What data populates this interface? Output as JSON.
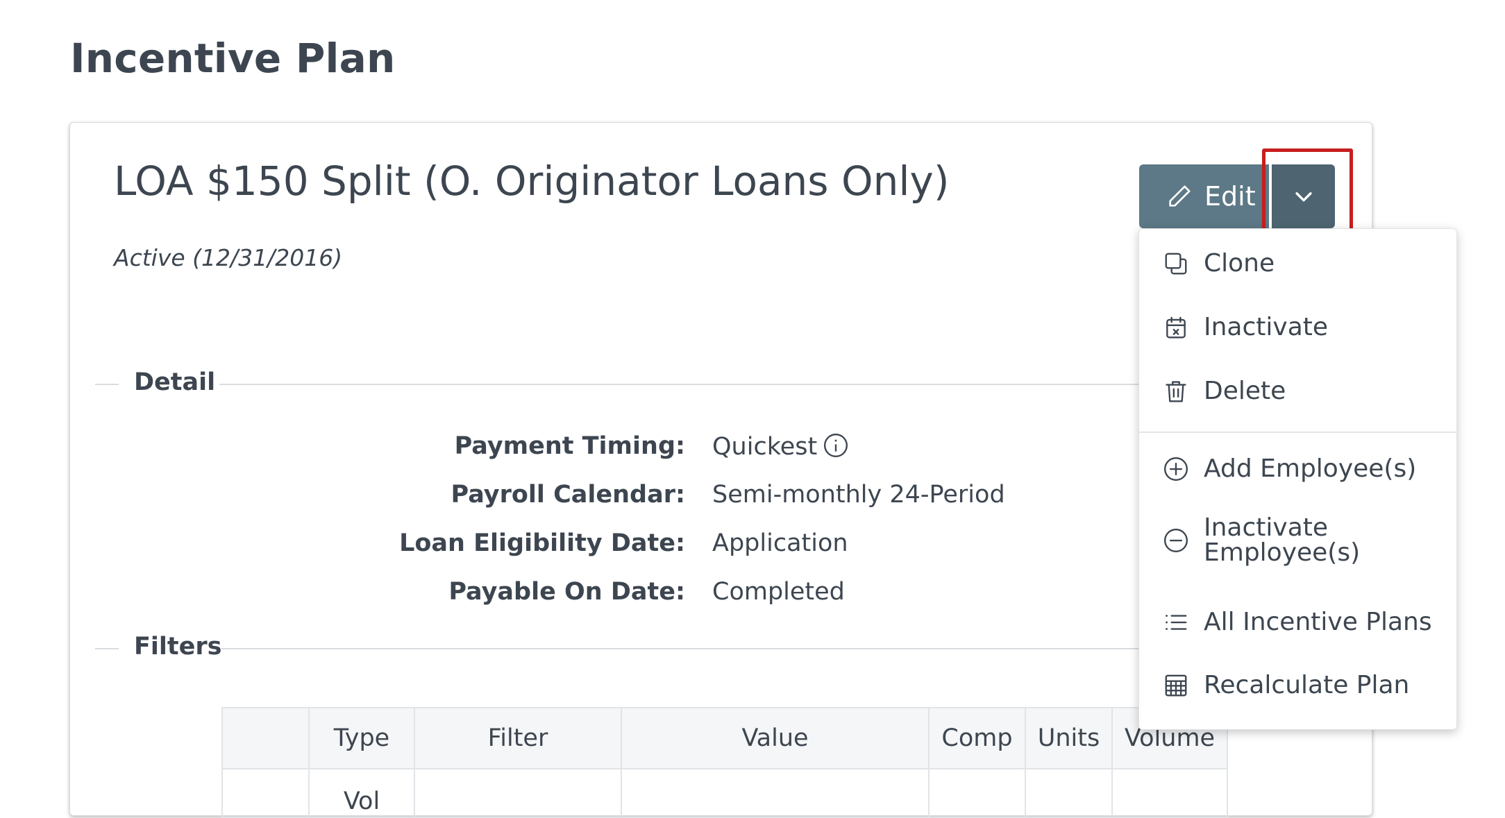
{
  "page": {
    "title": "Incentive Plan"
  },
  "plan": {
    "name": "LOA $150 Split (O. Originator Loans Only)",
    "status": "Active (12/31/2016)"
  },
  "actions": {
    "edit_label": "Edit"
  },
  "menu": {
    "items": [
      {
        "label": "Clone",
        "icon": "clone-icon"
      },
      {
        "label": "Inactivate",
        "icon": "calendar-x-icon"
      },
      {
        "label": "Delete",
        "icon": "trash-icon"
      },
      {
        "label": "Add Employee(s)",
        "icon": "plus-circle-icon"
      },
      {
        "label": "Inactivate Employee(s)",
        "icon": "minus-circle-icon"
      },
      {
        "label": "All Incentive Plans",
        "icon": "list-icon"
      },
      {
        "label": "Recalculate Plan",
        "icon": "calculator-icon"
      }
    ]
  },
  "detail": {
    "section_label": "Detail",
    "rows": [
      {
        "key": "Payment Timing:",
        "value": "Quickest"
      },
      {
        "key": "Payroll Calendar:",
        "value": "Semi-monthly 24-Period"
      },
      {
        "key": "Loan Eligibility Date:",
        "value": "Application"
      },
      {
        "key": "Payable On Date:",
        "value": "Completed"
      }
    ]
  },
  "filters": {
    "section_label": "Filters",
    "columns": [
      "",
      "Type",
      "Filter",
      "Value",
      "Comp",
      "Units",
      "Volume"
    ],
    "rows": [
      [
        "",
        "Vol",
        "",
        "",
        "",
        "",
        ""
      ]
    ]
  },
  "colors": {
    "edit_button": "#5d7886",
    "toggle_button": "#4e6470",
    "highlight": "#c81e1e"
  }
}
